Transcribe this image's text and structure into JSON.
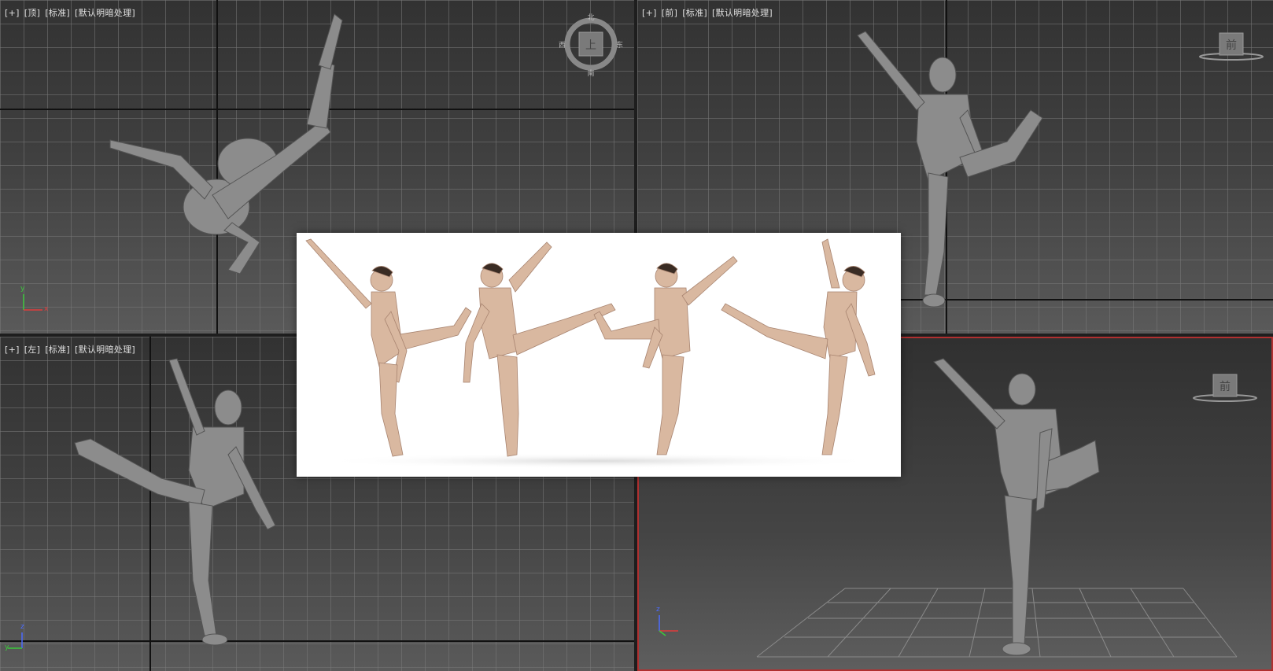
{
  "viewports": {
    "top": {
      "label": [
        "[+]",
        "[顶]",
        "[标准]",
        "[默认明暗处理]"
      ]
    },
    "front": {
      "label": [
        "[+]",
        "[前]",
        "[标准]",
        "[默认明暗处理]"
      ]
    },
    "left": {
      "label": [
        "[+]",
        "[左]",
        "[标准]",
        "[默认明暗处理]"
      ]
    },
    "perspective": {
      "label": []
    }
  },
  "viewcube_top": {
    "face": "上",
    "north": "北",
    "south": "南",
    "east": "东",
    "west": "西"
  },
  "viewcube_front": {
    "face": "前"
  },
  "viewcube_persp": {
    "face": "前"
  },
  "axes": {
    "x": "x",
    "y": "y",
    "z": "z"
  },
  "colors": {
    "active_border": "#b03030",
    "skin": "#d9b8a0",
    "mannequin": "#8c8c8c"
  },
  "reference_image": {
    "figures": 4
  }
}
